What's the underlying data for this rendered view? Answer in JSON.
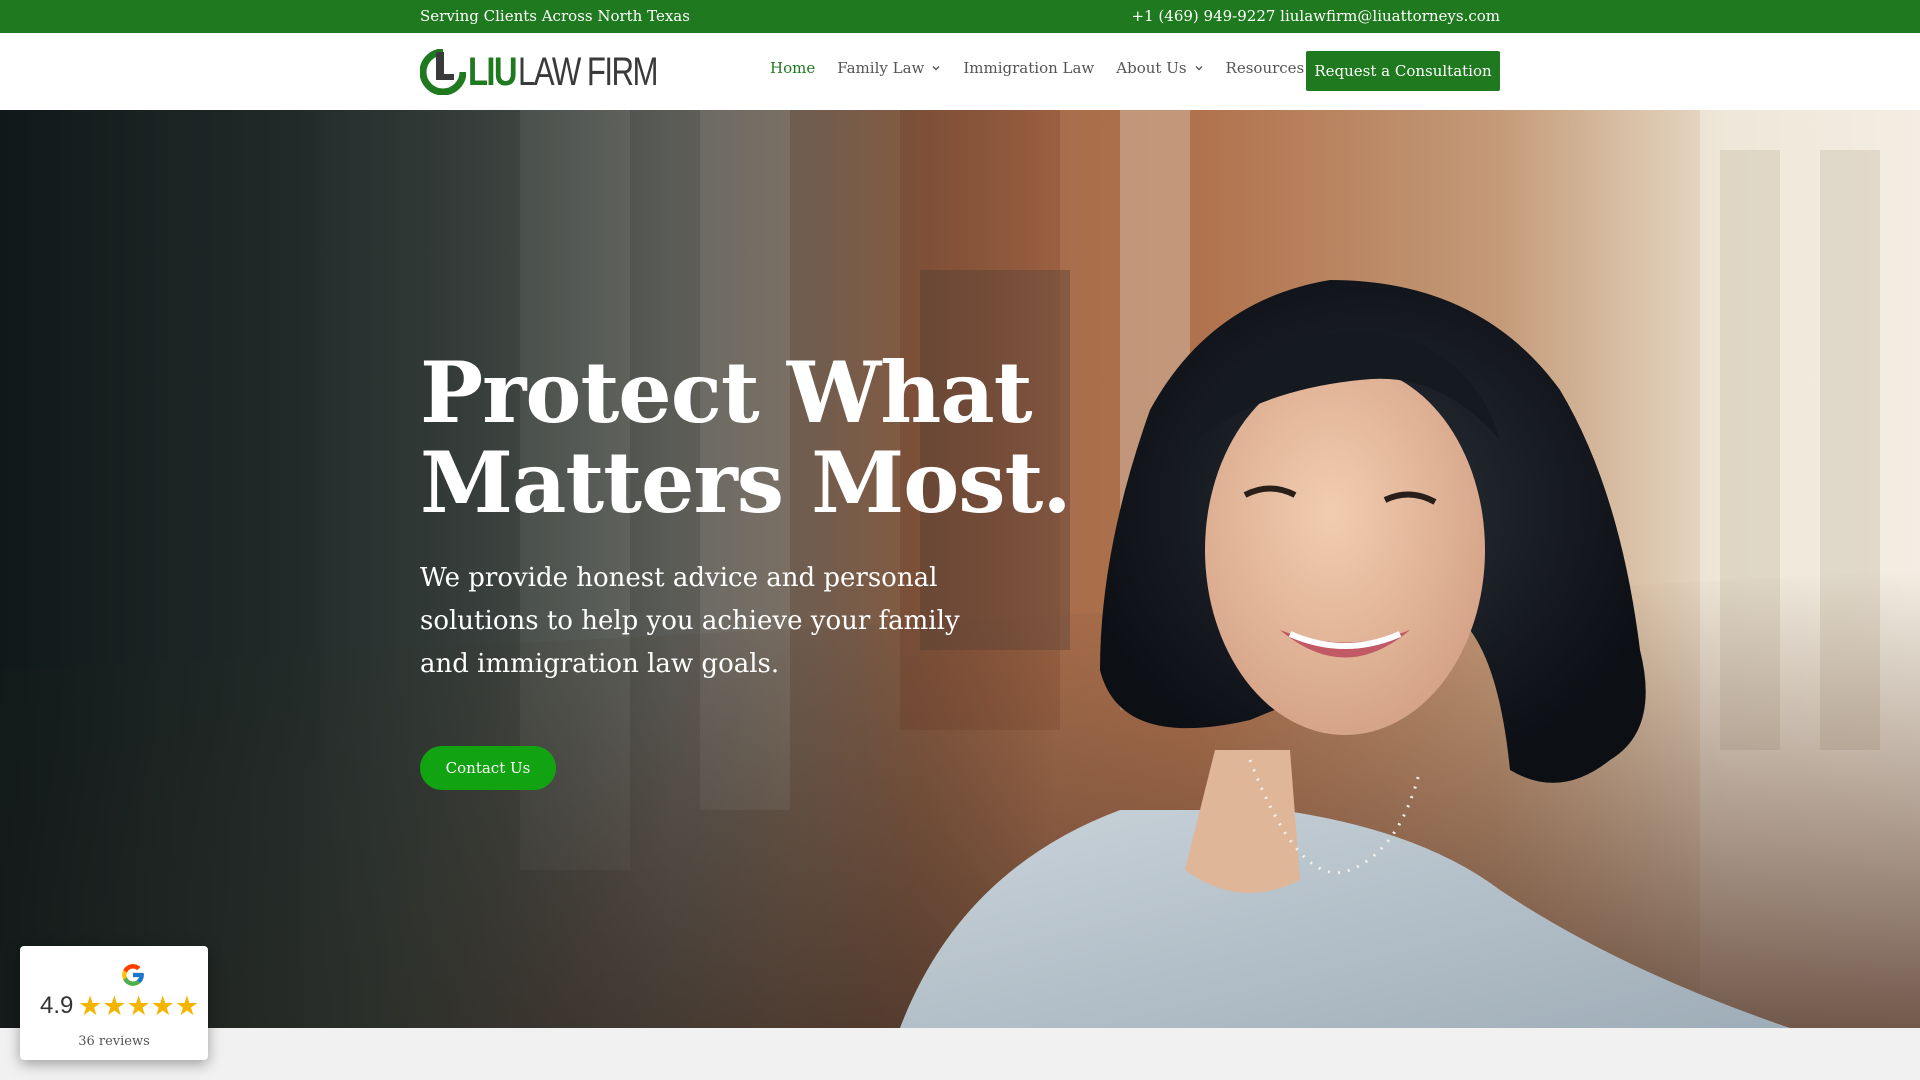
{
  "topbar": {
    "tagline": "Serving Clients Across North Texas",
    "contact": "+1 (469) 949-9227 liulawfirm@liuattorneys.com"
  },
  "logo": {
    "liu": "LIU",
    "lawfirm": "LAW FIRM"
  },
  "nav": {
    "items": [
      {
        "label": "Home",
        "dropdown": false,
        "active": true
      },
      {
        "label": "Family Law",
        "dropdown": true,
        "active": false
      },
      {
        "label": "Immigration Law",
        "dropdown": false,
        "active": false
      },
      {
        "label": "About Us",
        "dropdown": true,
        "active": false
      },
      {
        "label": "Resources",
        "dropdown": true,
        "active": false
      }
    ],
    "cta_label": "Request a Consultation"
  },
  "hero": {
    "title_line1": "Protect What",
    "title_line2": "Matters Most.",
    "subtitle": "We provide honest advice and personal solutions to help you achieve your family and immigration law goals.",
    "button_label": "Contact Us"
  },
  "google_badge": {
    "rating": "4.9",
    "stars": 5,
    "reviews": "36 reviews"
  },
  "colors": {
    "brand_green": "#1f7a1f",
    "button_green": "#12a312",
    "star_yellow": "#f4b400"
  }
}
